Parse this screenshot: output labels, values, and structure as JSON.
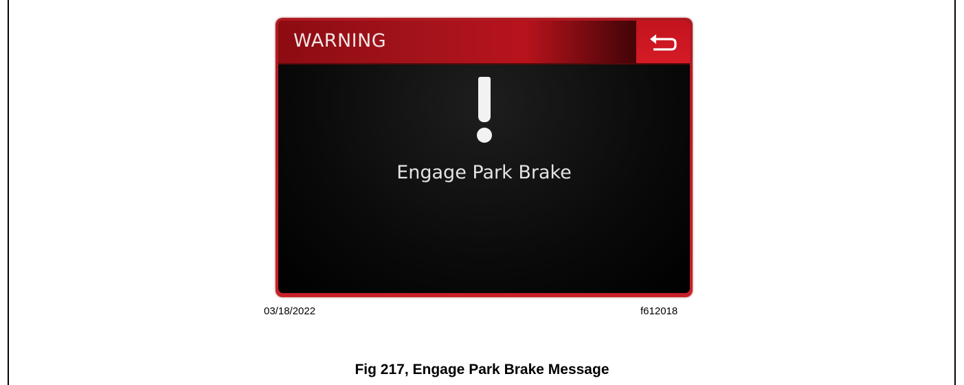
{
  "dialog": {
    "title": "WARNING",
    "back_icon": "return-arrow-icon",
    "alert_icon": "exclamation-icon",
    "message": "Engage Park Brake",
    "accent_color": "#c8202a",
    "background_color": "#000000"
  },
  "figure": {
    "date": "03/18/2022",
    "code": "f612018",
    "caption": "Fig 217, Engage Park Brake Message"
  }
}
